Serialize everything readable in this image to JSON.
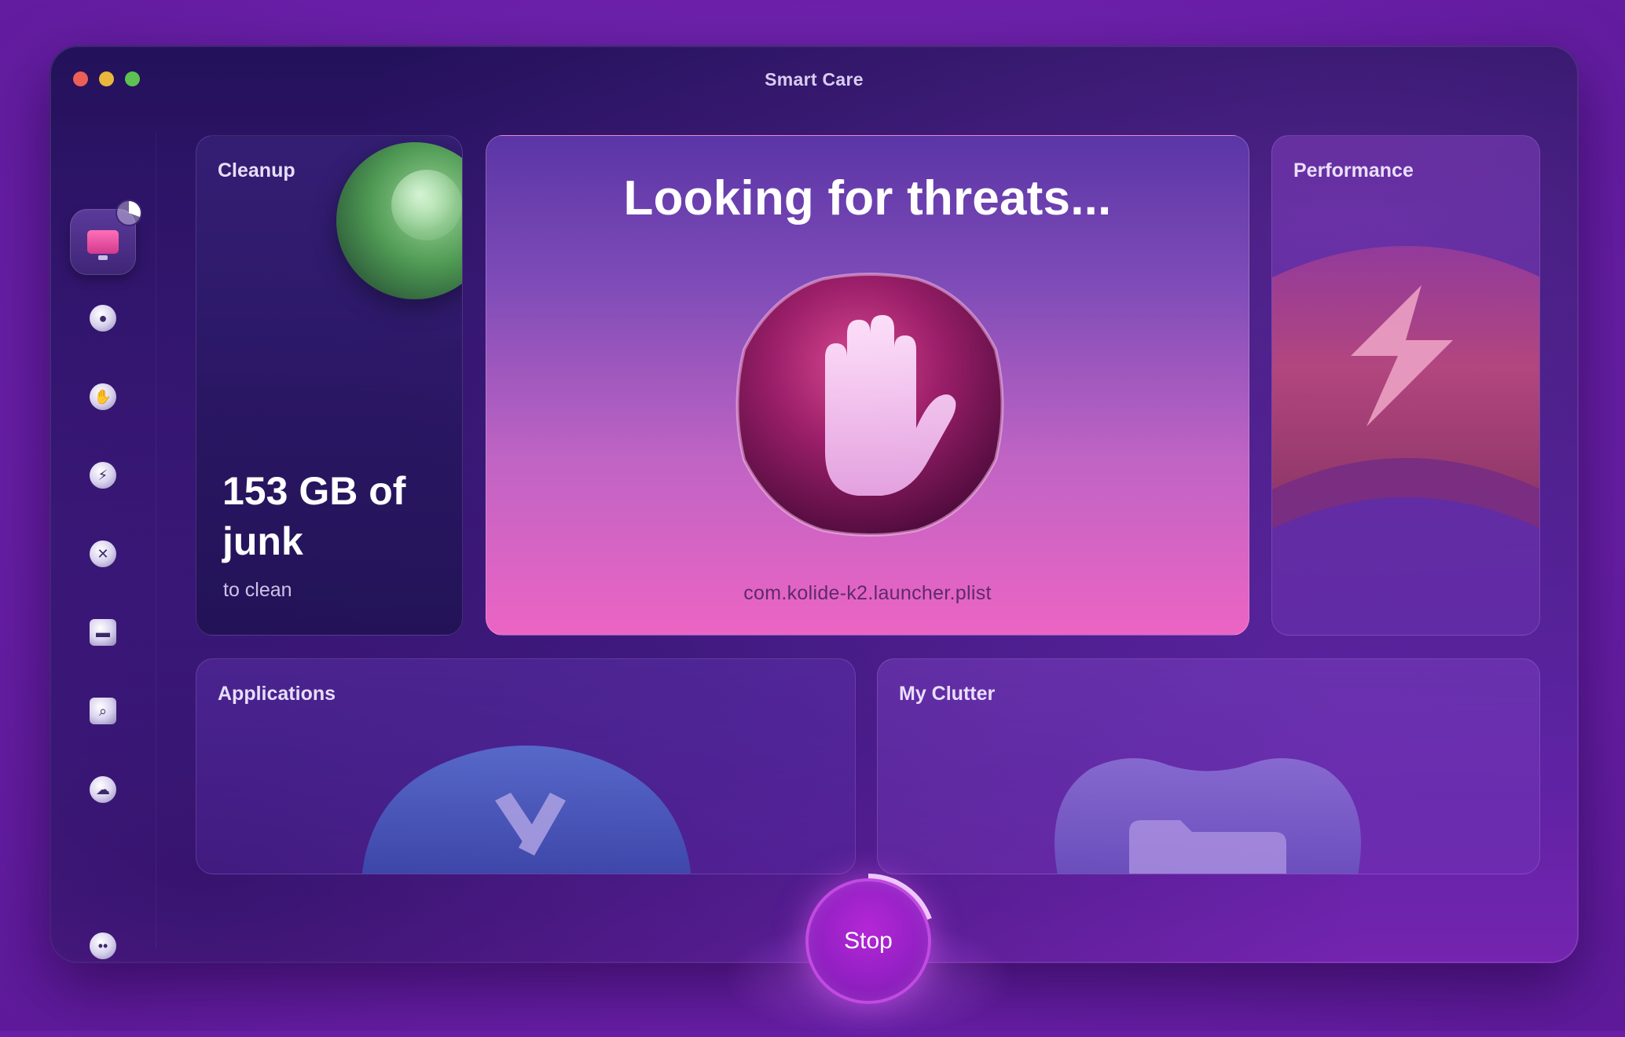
{
  "window": {
    "title": "Smart Care"
  },
  "sidebar": {
    "items": [
      {
        "name": "smart-care",
        "icon": "monitor-icon",
        "active": true
      },
      {
        "name": "cleanup",
        "icon": "disc-icon"
      },
      {
        "name": "protection",
        "icon": "hand-icon"
      },
      {
        "name": "performance",
        "icon": "bolt-icon"
      },
      {
        "name": "applications",
        "icon": "apps-icon"
      },
      {
        "name": "my-clutter",
        "icon": "folder-icon"
      },
      {
        "name": "space-lens",
        "icon": "magnifier-icon"
      },
      {
        "name": "cloud-cleanup",
        "icon": "cloud-icon"
      }
    ],
    "bottom_icon": "assistant-icon"
  },
  "cleanup": {
    "title": "Cleanup",
    "amount": "153 GB of junk",
    "subtitle": "to clean"
  },
  "protection_scan": {
    "heading": "Looking for threats...",
    "current_file": "com.kolide-k2.launcher.plist",
    "icon": "stop-hand-icon"
  },
  "performance": {
    "title": "Performance",
    "icon": "bolt-icon"
  },
  "applications": {
    "title": "Applications",
    "icon": "apps-icon"
  },
  "clutter": {
    "title": "My Clutter",
    "icon": "folder-icon"
  },
  "controls": {
    "stop_label": "Stop"
  },
  "colors": {
    "background": "#6a1fa8",
    "accent": "#ec64c4",
    "stop_button": "#9420c4"
  }
}
